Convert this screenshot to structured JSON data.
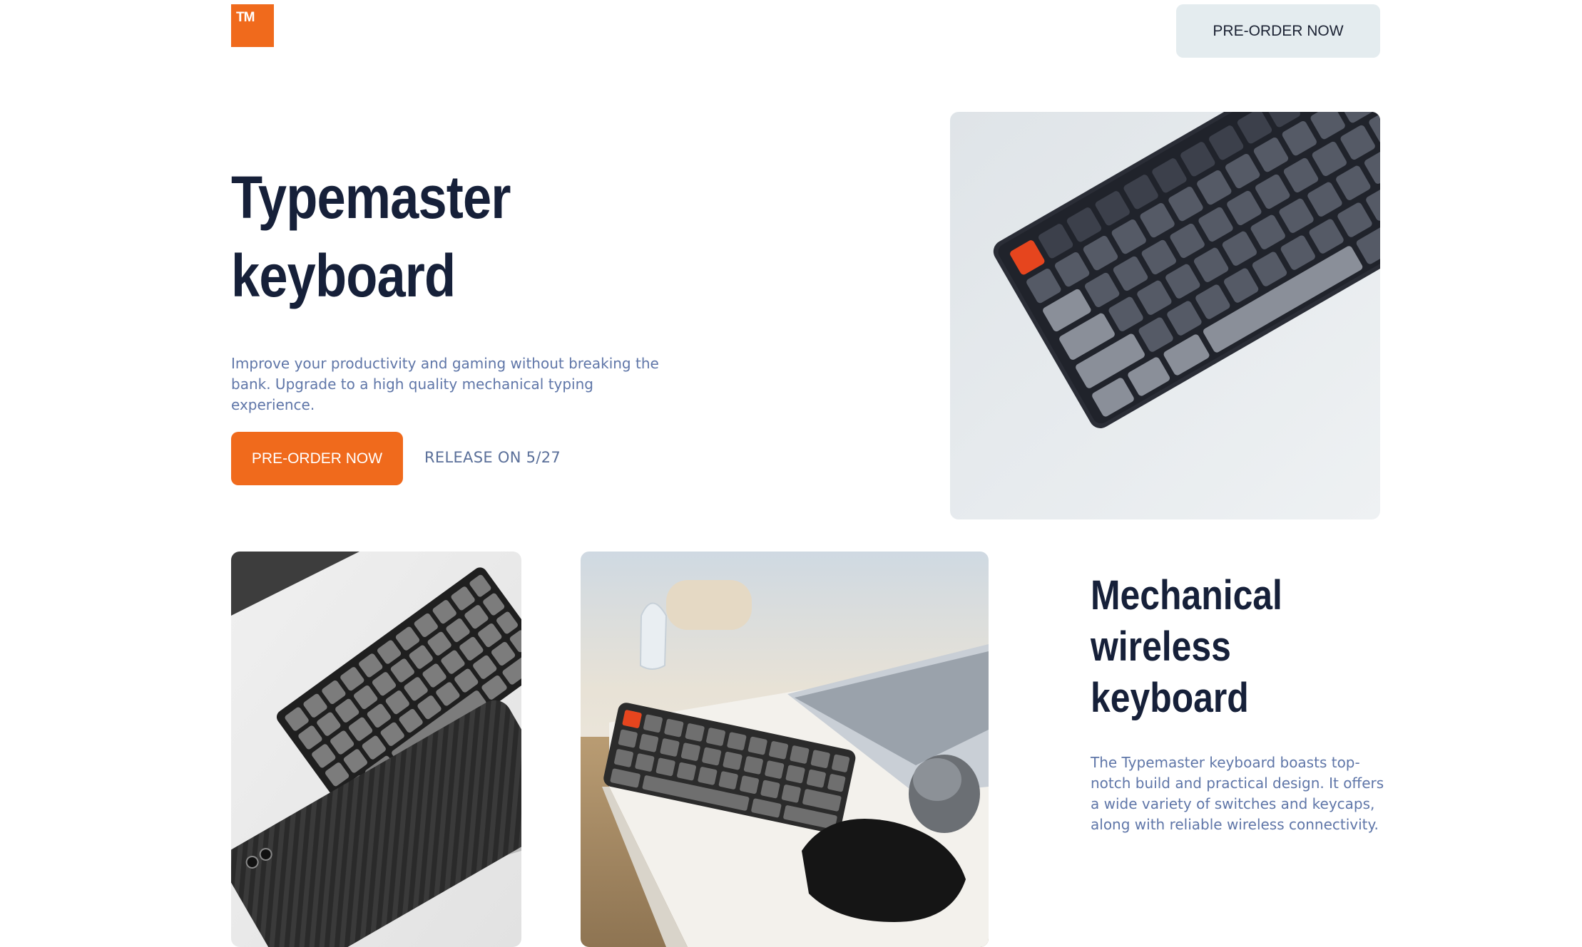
{
  "header": {
    "logo_text": "TM",
    "cta_label": "PRE-ORDER NOW"
  },
  "hero": {
    "title": "Typemaster keyboard",
    "description": "Improve your productivity and gaming without breaking the bank. Upgrade to a high quality mechanical typing experience.",
    "cta_label": "PRE-ORDER NOW",
    "release_text": "RELEASE ON 5/27"
  },
  "feature": {
    "title": "Mechanical wireless keyboard",
    "description": "The Typemaster keyboard boasts top-notch build and practical design. It offers a wide variety of switches and keycaps, along with reliable wireless connectivity."
  },
  "colors": {
    "accent": "#f06a1c",
    "heading": "#162039",
    "body_text": "#5f76a8",
    "secondary_button": "#e4ecef"
  }
}
